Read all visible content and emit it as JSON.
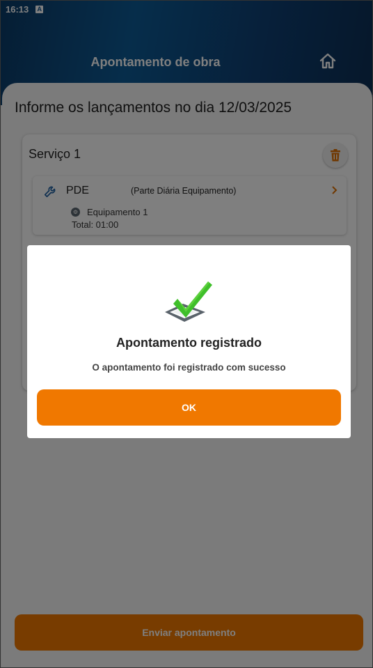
{
  "status": {
    "time": "16:13",
    "notification_glyph": "A"
  },
  "header": {
    "title": "Apontamento de obra",
    "home_icon": "home-icon"
  },
  "main": {
    "title": "Informe os lançamentos no dia 12/03/2025",
    "service": {
      "title": "Serviço 1",
      "delete_icon": "trash-icon",
      "entries": [
        {
          "code": "PDE",
          "description": "(Parte Diária Equipamento)",
          "equipment": "Equipamento 1",
          "total": "Total: 01:00",
          "icon": "wrench-icon"
        }
      ]
    }
  },
  "footer": {
    "send_label": "Enviar apontamento"
  },
  "dialog": {
    "title": "Apontamento registrado",
    "message": "O apontamento foi registrado com sucesso",
    "ok_label": "OK",
    "icon": "checkmark-box-icon"
  },
  "colors": {
    "accent": "#f07800",
    "header": "#0d5b96",
    "check": "#3fbf2a"
  }
}
